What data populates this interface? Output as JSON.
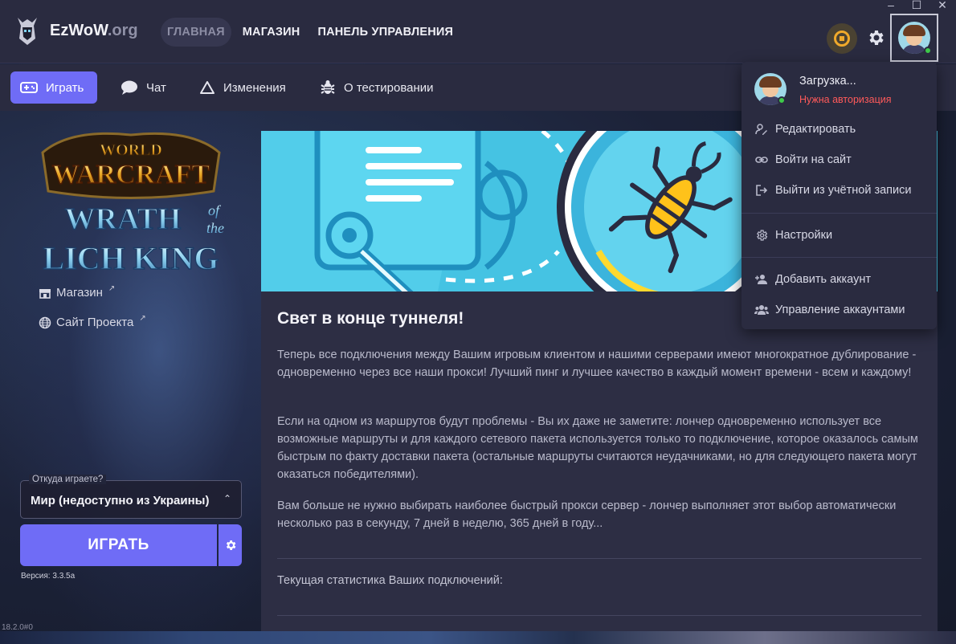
{
  "brand": {
    "name": "EzWoW",
    "tld": ".org"
  },
  "top_nav": [
    {
      "label": "ГЛАВНАЯ",
      "active": true
    },
    {
      "label": "МАГАЗИН",
      "active": false
    },
    {
      "label": "ПАНЕЛЬ УПРАВЛЕНИЯ",
      "active": false
    }
  ],
  "window_controls": {
    "minimize": "–",
    "maximize": "☐",
    "close": "✕"
  },
  "sub_nav": [
    {
      "label": "Играть",
      "icon": "gamepad-icon",
      "active": true
    },
    {
      "label": "Чат",
      "icon": "chat-bubble-icon",
      "active": false
    },
    {
      "label": "Изменения",
      "icon": "triangle-icon",
      "active": false
    },
    {
      "label": "О тестировании",
      "icon": "bug-icon",
      "active": false
    }
  ],
  "sidebar": {
    "links": [
      {
        "label": "Магазин",
        "icon": "store-icon"
      },
      {
        "label": "Сайт Проекта",
        "icon": "globe-icon"
      }
    ],
    "region_label": "Откуда играете?",
    "region_value": "Мир (недоступно из Украины)",
    "play_label": "ИГРАТЬ",
    "version": "Версия: 3.3.5a",
    "build": "18.2.0#0"
  },
  "card": {
    "title": "Свет в конце туннеля!",
    "paragraphs": [
      "Теперь все подключения между Вашим игровым клиентом и нашими серверами имеют многократное дублирование - одновременно через все наши прокси! Лучший пинг и лучшее качество в каждый момент времени - всем и каждому!",
      "Если на одном из маршрутов будут проблемы - Вы их даже не заметите: лончер одновременно использует все возможные маршруты и для каждого сетевого пакета используется только то подключение, которое оказалось самым быстрым по факту доставки пакета (остальные маршруты считаются неудачниками, но для следующего пакета могут оказаться победителями).",
      "Вам больше не нужно выбирать наиболее быстрый прокси сервер - лончер выполняет этот выбор автоматически несколько раз в секунду, 7 дней в неделю, 365 дней в году..."
    ],
    "stats_label": "Текущая статистика Ваших подключений:"
  },
  "account_menu": {
    "name": "Загрузка...",
    "auth_status": "Нужна авторизация",
    "items": [
      {
        "label": "Редактировать",
        "icon": "user-edit-icon"
      },
      {
        "label": "Войти на сайт",
        "icon": "link-icon"
      },
      {
        "label": "Выйти из учётной записи",
        "icon": "logout-icon"
      },
      {
        "label": "Настройки",
        "icon": "gear-icon"
      },
      {
        "label": "Добавить аккаунт",
        "icon": "add-user-icon"
      },
      {
        "label": "Управление аккаунтами",
        "icon": "users-icon"
      }
    ]
  },
  "colors": {
    "accent": "#6f6cf6",
    "error": "#ff5a5a",
    "status": "#f0a92b",
    "online": "#3ec94a"
  }
}
